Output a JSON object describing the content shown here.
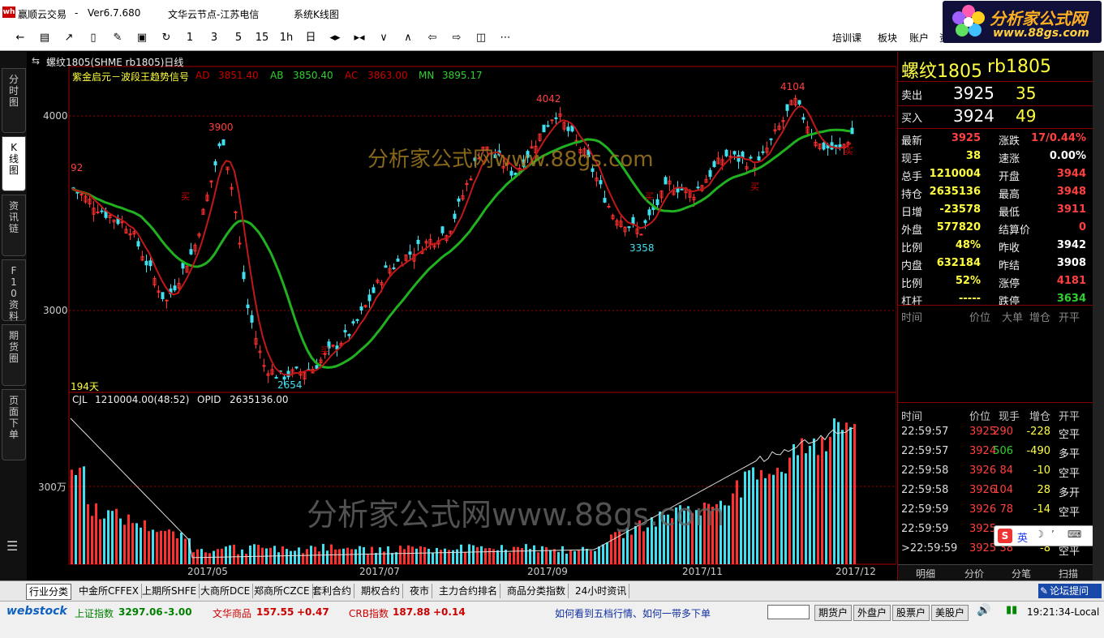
{
  "window": {
    "app_title": "赢顺云交易",
    "version": "Ver6.7.680",
    "server": "文华云节点-江苏电信",
    "view": "系统K线图"
  },
  "logo": {
    "name": "分析家公式网",
    "url": "www.88gs.com"
  },
  "toolbar": {
    "icons": [
      "back-icon",
      "list-icon",
      "line-chart-icon",
      "kline-icon",
      "draw-icon",
      "save-icon",
      "refresh-icon"
    ],
    "periods": [
      "1",
      "3",
      "5",
      "15",
      "1h",
      "日"
    ],
    "right_items": [
      "培训课",
      "板块",
      "账户",
      "资"
    ]
  },
  "left_tabs": [
    "分时图",
    "K线图",
    "资讯链",
    "F10资料",
    "期货圈",
    "页面下单"
  ],
  "chart": {
    "instrument_line": "螺纹1805(SHME rb1805)日线",
    "indicator_name": "紫金启元－波段王趋势信号",
    "indicators": [
      {
        "name": "AD",
        "value": "3851.40",
        "color": "#ff3030"
      },
      {
        "name": "AB",
        "value": "3850.40",
        "color": "#30d030"
      },
      {
        "name": "AC",
        "value": "3863.00",
        "color": "#ff3030"
      },
      {
        "name": "MN",
        "value": "3895.17",
        "color": "#30d030"
      }
    ],
    "y_labels": [
      "4000",
      "3000"
    ],
    "price_marks": [
      "92",
      "3900",
      "4042",
      "4104",
      "3358",
      "2654"
    ],
    "days_label": "194天",
    "volume_title": "CJL",
    "volume_value": "1210004.00(48:52)",
    "opid_label": "OPID",
    "opid_value": "2635136.00",
    "volume_y_label": "300万",
    "x_labels": [
      "2017/05",
      "2017/07",
      "2017/09",
      "2017/11",
      "2017/12"
    ],
    "watermark_top": "分析家公式网www.88gs.com",
    "watermark_bottom": "分析家公式网www.88gs.com",
    "signal_mark": "买"
  },
  "quote": {
    "name": "螺纹1805",
    "code": "rb1805",
    "ask_label": "卖出",
    "ask_price": "3925",
    "ask_vol": "35",
    "bid_label": "买入",
    "bid_price": "3924",
    "bid_vol": "49",
    "fields": [
      {
        "l": "最新",
        "v": "3925",
        "vc": "#ff4040",
        "l2": "涨跌",
        "v2": "17/0.44%",
        "v2c": "#ff4040"
      },
      {
        "l": "现手",
        "v": "38",
        "vc": "#ffff40",
        "l2": "速涨",
        "v2": "0.00%",
        "v2c": "#ffffff"
      },
      {
        "l": "总手",
        "v": "1210004",
        "vc": "#ffff40",
        "l2": "开盘",
        "v2": "3944",
        "v2c": "#ff4040"
      },
      {
        "l": "持仓",
        "v": "2635136",
        "vc": "#ffff40",
        "l2": "最高",
        "v2": "3948",
        "v2c": "#ff4040"
      },
      {
        "l": "日增",
        "v": "-23578",
        "vc": "#ffff40",
        "l2": "最低",
        "v2": "3911",
        "v2c": "#ff4040"
      },
      {
        "l": "外盘",
        "v": "577820",
        "vc": "#ffff40",
        "l2": "结算价",
        "v2": "0",
        "v2c": "#ff4040"
      },
      {
        "l": "比例",
        "v": "48%",
        "vc": "#ffff40",
        "l2": "昨收",
        "v2": "3942",
        "v2c": "#ffffff"
      },
      {
        "l": "内盘",
        "v": "632184",
        "vc": "#ffff40",
        "l2": "昨结",
        "v2": "3908",
        "v2c": "#ffffff"
      },
      {
        "l": "比例",
        "v": "52%",
        "vc": "#ffff40",
        "l2": "涨停",
        "v2": "4181",
        "v2c": "#ff4040"
      },
      {
        "l": "杠杆",
        "v": "-----",
        "vc": "#ffff40",
        "l2": "跌停",
        "v2": "3634",
        "v2c": "#30d030"
      }
    ],
    "ticks_header": [
      "时间",
      "价位",
      "大单",
      "增仓",
      "开平"
    ],
    "ticks2_header": [
      "时间",
      "价位",
      "现手",
      "增仓",
      "开平"
    ],
    "ticks": [
      {
        "t": "22:59:57",
        "p": "3925",
        "v": "290",
        "d": "-228",
        "o": "空平",
        "vc": "#ff4040",
        "dc": "#ffff40"
      },
      {
        "t": "22:59:57",
        "p": "3924",
        "v": "506",
        "d": "-490",
        "o": "多平",
        "vc": "#30d030",
        "dc": "#ffff40"
      },
      {
        "t": "22:59:58",
        "p": "3926",
        "v": "84",
        "d": "-10",
        "o": "空平",
        "vc": "#ff4040",
        "dc": "#ffff40"
      },
      {
        "t": "22:59:58",
        "p": "3926",
        "v": "104",
        "d": "28",
        "o": "多开",
        "vc": "#ff4040",
        "dc": "#ffff40"
      },
      {
        "t": "22:59:59",
        "p": "3926",
        "v": "78",
        "d": "-14",
        "o": "空平",
        "vc": "#ff4040",
        "dc": "#ffff40"
      },
      {
        "t": "22:59:59",
        "p": "3925",
        "v": "",
        "d": "",
        "o": "",
        "vc": "#ff4040",
        "dc": "#ffff40"
      },
      {
        "t": ">22:59:59",
        "p": "3925",
        "v": "38",
        "d": "-8",
        "o": "空平",
        "vc": "#ff4040",
        "dc": "#ffff40"
      }
    ],
    "bottom_tabs": [
      "明细",
      "分价",
      "分笔",
      "扫描"
    ]
  },
  "sheet_tabs": [
    "行业分类",
    "中金所CFFEX",
    "上期所SHFE",
    "大商所DCE",
    "郑商所CZCE",
    "套利合约",
    "期权合约",
    "夜市",
    "主力合约排名",
    "商品分类指数",
    "24小时资讯"
  ],
  "ime": {
    "brand": "S",
    "lang": "英"
  },
  "forum": "论坛提问",
  "status": {
    "brand": "webstock",
    "idx1_name": "上证指数",
    "idx1_val": "3297.06",
    "idx1_chg": "-3.00",
    "idx2_name": "文华商品",
    "idx2_val": "157.55",
    "idx2_chg": "+0.47",
    "idx3_name": "CRB指数",
    "idx3_val": "187.88",
    "idx3_chg": "+0.14",
    "news": "如何看到五档行情、如何一带多下单",
    "btns": [
      "期货户",
      "外盘户",
      "股票户",
      "美股户"
    ],
    "time": "19:21:34-Local"
  }
}
